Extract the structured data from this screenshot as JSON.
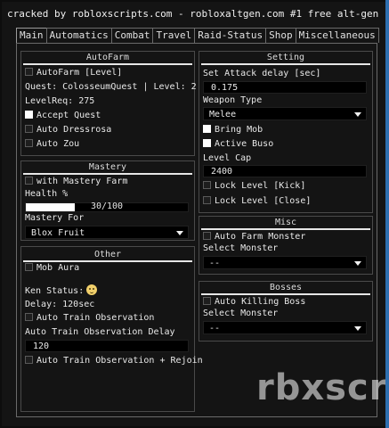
{
  "window": {
    "title": "cracked by robloxscripts.com - robloxaltgen.com #1 free alt-gen"
  },
  "tabs": [
    {
      "label": "Main",
      "active": true
    },
    {
      "label": "Automatics",
      "active": false
    },
    {
      "label": "Combat",
      "active": false
    },
    {
      "label": "Travel",
      "active": false
    },
    {
      "label": "Raid-Status",
      "active": false
    },
    {
      "label": "Shop",
      "active": false
    },
    {
      "label": "Miscellaneous",
      "active": false
    }
  ],
  "autofarm": {
    "title": "AutoFarm",
    "autofarm_level": {
      "label": "AutoFarm [Level]",
      "checked": false
    },
    "quest": "Quest: ColosseumQuest | Level: 2",
    "level_req": "LevelReq: 275",
    "accept_quest": {
      "label": "Accept Quest",
      "checked": true
    },
    "auto_dressrosa": {
      "label": "Auto Dressrosa",
      "checked": false
    },
    "auto_zou": {
      "label": "Auto Zou",
      "checked": false
    }
  },
  "mastery": {
    "title": "Mastery",
    "with_mastery_farm": {
      "label": "with Mastery Farm",
      "checked": false
    },
    "health_label": "Health %",
    "health_value": 30,
    "health_text": "30/100",
    "mastery_for_label": "Mastery For",
    "mastery_for_value": "Blox Fruit"
  },
  "other": {
    "title": "Other",
    "mob_aura": {
      "label": "Mob Aura",
      "checked": false
    },
    "ken_status": "Ken Status:",
    "delay": "Delay: 120sec",
    "auto_train_observation": {
      "label": "Auto Train Observation",
      "checked": false
    },
    "observation_delay_label": "Auto Train Observation Delay",
    "observation_delay_value": "120",
    "auto_train_rejoin": {
      "label": "Auto Train Observation + Rejoin",
      "checked": false
    }
  },
  "setting": {
    "title": "Setting",
    "attack_delay_label": "Set Attack delay [sec]",
    "attack_delay_value": "0.175",
    "weapon_type_label": "Weapon Type",
    "weapon_type_value": "Melee",
    "bring_mob": {
      "label": "Bring Mob",
      "checked": true
    },
    "active_buso": {
      "label": "Active Buso",
      "checked": true
    },
    "level_cap_label": "Level Cap",
    "level_cap_value": "2400",
    "lock_level_kick": {
      "label": "Lock Level [Kick]",
      "checked": false
    },
    "lock_level_close": {
      "label": "Lock Level [Close]",
      "checked": false
    }
  },
  "misc": {
    "title": "Misc",
    "auto_farm_monster": {
      "label": "Auto Farm Monster",
      "checked": false
    },
    "select_monster_label": "Select Monster",
    "select_monster_value": "--"
  },
  "bosses": {
    "title": "Bosses",
    "auto_killing_boss": {
      "label": "Auto Killing Boss",
      "checked": false
    },
    "select_monster_label": "Select Monster",
    "select_monster_value": "--"
  },
  "watermark": "rbxscr",
  "colors": {
    "background": "#141414",
    "desktop": "#2e6fb0",
    "accent": "#ffffff"
  }
}
